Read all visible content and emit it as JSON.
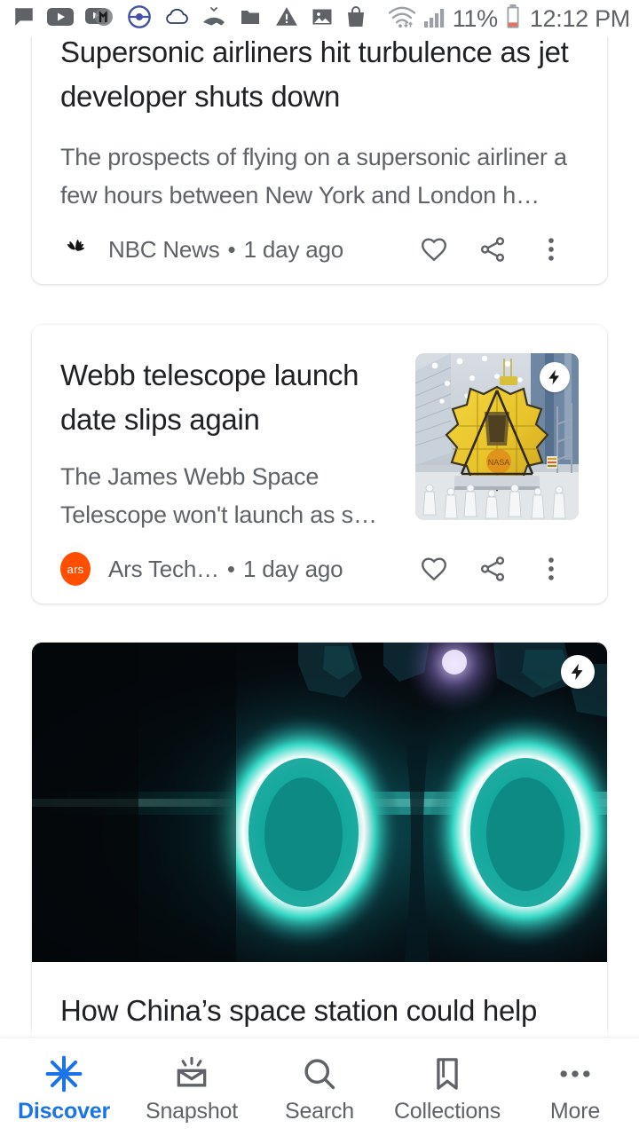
{
  "status_bar": {
    "icons": [
      {
        "name": "messages-icon"
      },
      {
        "name": "youtube-icon"
      },
      {
        "name": "youtube-music-icon"
      },
      {
        "name": "pokemon-go-icon"
      },
      {
        "name": "cloud-icon"
      },
      {
        "name": "missed-call-icon"
      },
      {
        "name": "folder-icon"
      },
      {
        "name": "warning-icon"
      },
      {
        "name": "image-icon"
      },
      {
        "name": "shopping-bag-icon"
      }
    ],
    "wifi_icon": "wifi-icon",
    "signal_icon": "cellular-signal-icon",
    "battery_percent": "11%",
    "battery_icon": "battery-low-icon",
    "time": "12:12 PM"
  },
  "feed": {
    "cards": [
      {
        "headline": "Supersonic airliners hit turbulence as jet developer shuts down",
        "snippet": "The prospects of flying on a supersonic airliner a few hours between New York and London h…",
        "source": "NBC News",
        "source_logo": "nbc-peacock-logo",
        "separator": "•",
        "time": "1 day ago",
        "actions": [
          "heart-icon",
          "share-icon",
          "more-vert-icon"
        ]
      },
      {
        "headline": "Webb telescope launch date slips again",
        "snippet": "The James Webb Space Telescope won't launch as s…",
        "source": "Ars Tech…",
        "source_logo": "ars-technica-logo",
        "source_logo_text": "ars",
        "separator": "•",
        "time": "1 day ago",
        "actions": [
          "heart-icon",
          "share-icon",
          "more-vert-icon"
        ],
        "thumbnail": "james-webb-telescope-photo",
        "amp_badge": "amp-lightning-icon"
      },
      {
        "headline": "How China’s space station could help power astronauts to Mars",
        "image": "ion-thruster-glowing-rings-photo",
        "amp_badge": "amp-lightning-icon"
      }
    ]
  },
  "bottom_nav": {
    "items": [
      {
        "label": "Discover",
        "icon": "discover-asterisk-icon",
        "active": true
      },
      {
        "label": "Snapshot",
        "icon": "snapshot-tray-icon",
        "active": false
      },
      {
        "label": "Search",
        "icon": "search-magnifier-icon",
        "active": false
      },
      {
        "label": "Collections",
        "icon": "collections-bookmark-icon",
        "active": false
      },
      {
        "label": "More",
        "icon": "more-horizontal-icon",
        "active": false
      }
    ]
  },
  "colors": {
    "accent": "#1a73e8",
    "text_primary": "#202124",
    "text_secondary": "#5f6368",
    "ars_orange": "#ff4e00",
    "card_bg": "#ffffff"
  }
}
